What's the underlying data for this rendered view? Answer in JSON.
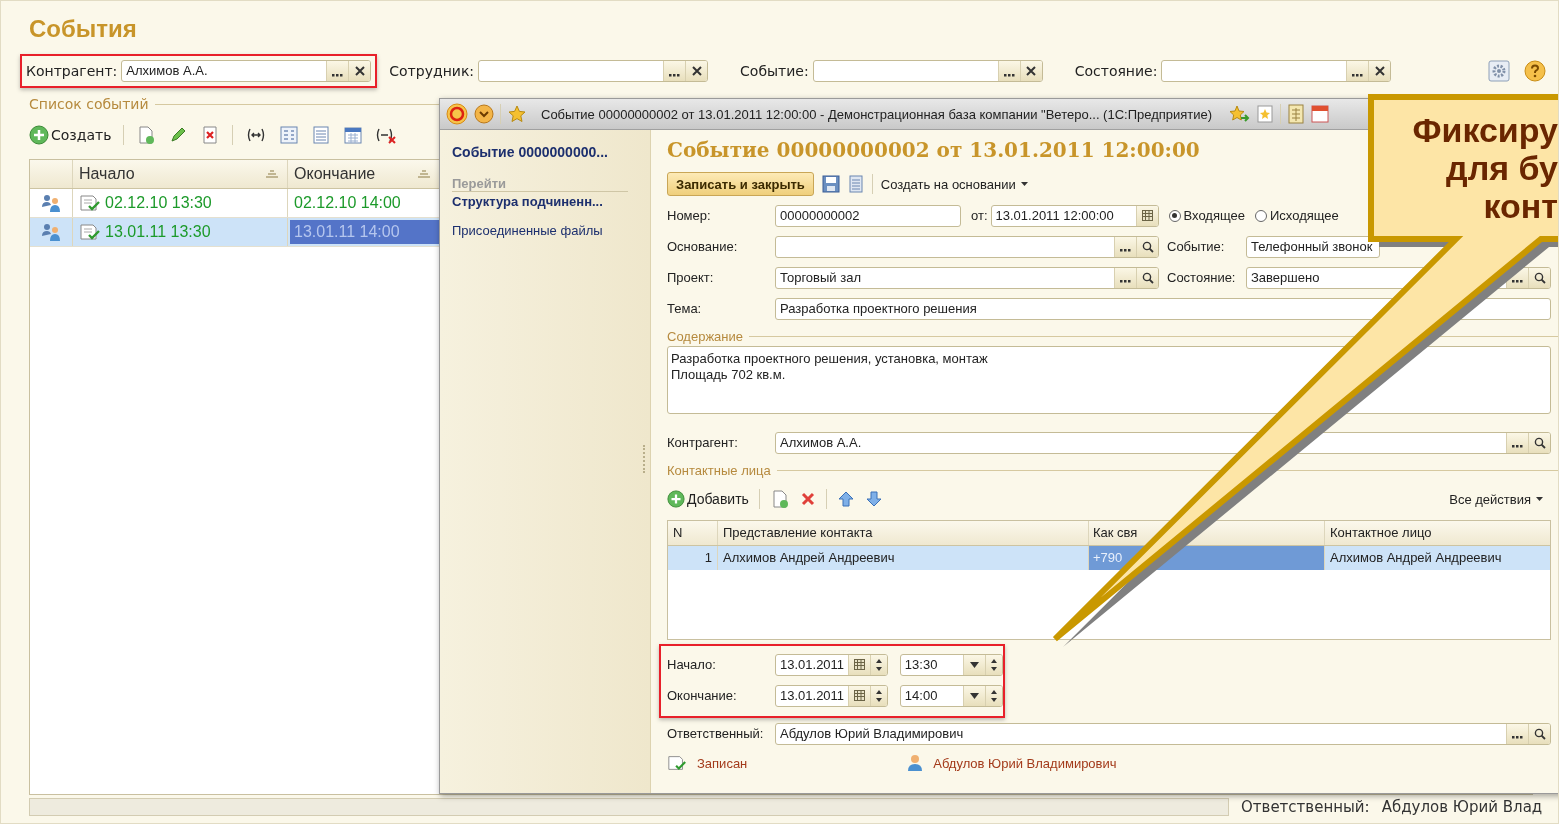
{
  "page": {
    "title": "События",
    "filters": [
      {
        "label": "Контрагент:",
        "value": "Алхимов А.А.",
        "highlighted": true
      },
      {
        "label": "Сотрудник:",
        "highlighted": false
      },
      {
        "label": "Событие:",
        "highlighted": false
      },
      {
        "label": "Состояние:",
        "highlighted": false
      }
    ],
    "list": {
      "title": "Список событий",
      "create": "Создать",
      "columns": [
        "Начало",
        "Окончание"
      ],
      "rows": [
        {
          "start": "02.12.10 13:30",
          "end": "02.12.10 14:00",
          "selected": false
        },
        {
          "start": "13.01.11 13:30",
          "end": "13.01.11 14:00",
          "selected": true
        }
      ]
    },
    "background_field": {
      "label": "Ответственный:",
      "value": "Абдулов Юрий Влад"
    }
  },
  "window": {
    "title": "Событие 00000000002 от 13.01.2011 12:00:00 - Демонстрационная база компании \"Ветеро...  (1С:Предприятие)",
    "nav": {
      "current": "Событие 0000000000...",
      "section": "Перейти",
      "items": [
        {
          "label": "Структура подчиненн...",
          "kind": "strong"
        },
        {
          "label": "Присоединенные файлы",
          "kind": "plain"
        }
      ]
    },
    "form": {
      "heading": "Событие 00000000002 от 13.01.2011 12:00:00",
      "save_close": "Записать и закрыть",
      "create_based": "Создать на основании",
      "number": {
        "label": "Номер:",
        "value": "00000000002"
      },
      "date": {
        "label": "от:",
        "value": "13.01.2011 12:00:00"
      },
      "direction": [
        {
          "label": "Входящее",
          "selected": true
        },
        {
          "label": "Исходящее",
          "selected": false
        }
      ],
      "basis": {
        "label": "Основание:"
      },
      "event": {
        "label": "Событие:",
        "value": "Телефонный звонок"
      },
      "project": {
        "label": "Проект:",
        "value": "Торговый зал"
      },
      "state": {
        "label": "Состояние:",
        "value": "Завершено"
      },
      "topic": {
        "label": "Тема:",
        "value": "Разработка проектного решения"
      },
      "content": {
        "title": "Содержание",
        "value": "Разработка проектного решения, установка, монтаж\nПлощадь 702 кв.м."
      },
      "contractor": {
        "label": "Контрагент:",
        "value": "Алхимов А.А."
      },
      "contacts": {
        "title": "Контактные лица",
        "add": "Добавить",
        "all_actions": "Все действия",
        "columns": [
          "N",
          "Представление контакта",
          "Как свя",
          "Контактное лицо"
        ],
        "rows": [
          {
            "n": "1",
            "name": "Алхимов Андрей Андреевич",
            "phone": "+790",
            "person": "Алхимов Андрей Андреевич",
            "selected": true
          }
        ]
      },
      "period": {
        "highlighted": true,
        "start": {
          "label": "Начало:",
          "date": "13.01.2011",
          "time": "13:30"
        },
        "end": {
          "label": "Окончание:",
          "date": "13.01.2011",
          "time": "14:00"
        }
      },
      "responsible": {
        "label": "Ответственный:",
        "value": "Абдулов Юрий Владимирович"
      },
      "status": "Записан",
      "author": "Абдулов Юрий Владимирович"
    }
  },
  "callout": {
    "lines": [
      "Фиксиру",
      "для бу",
      "конт"
    ]
  }
}
